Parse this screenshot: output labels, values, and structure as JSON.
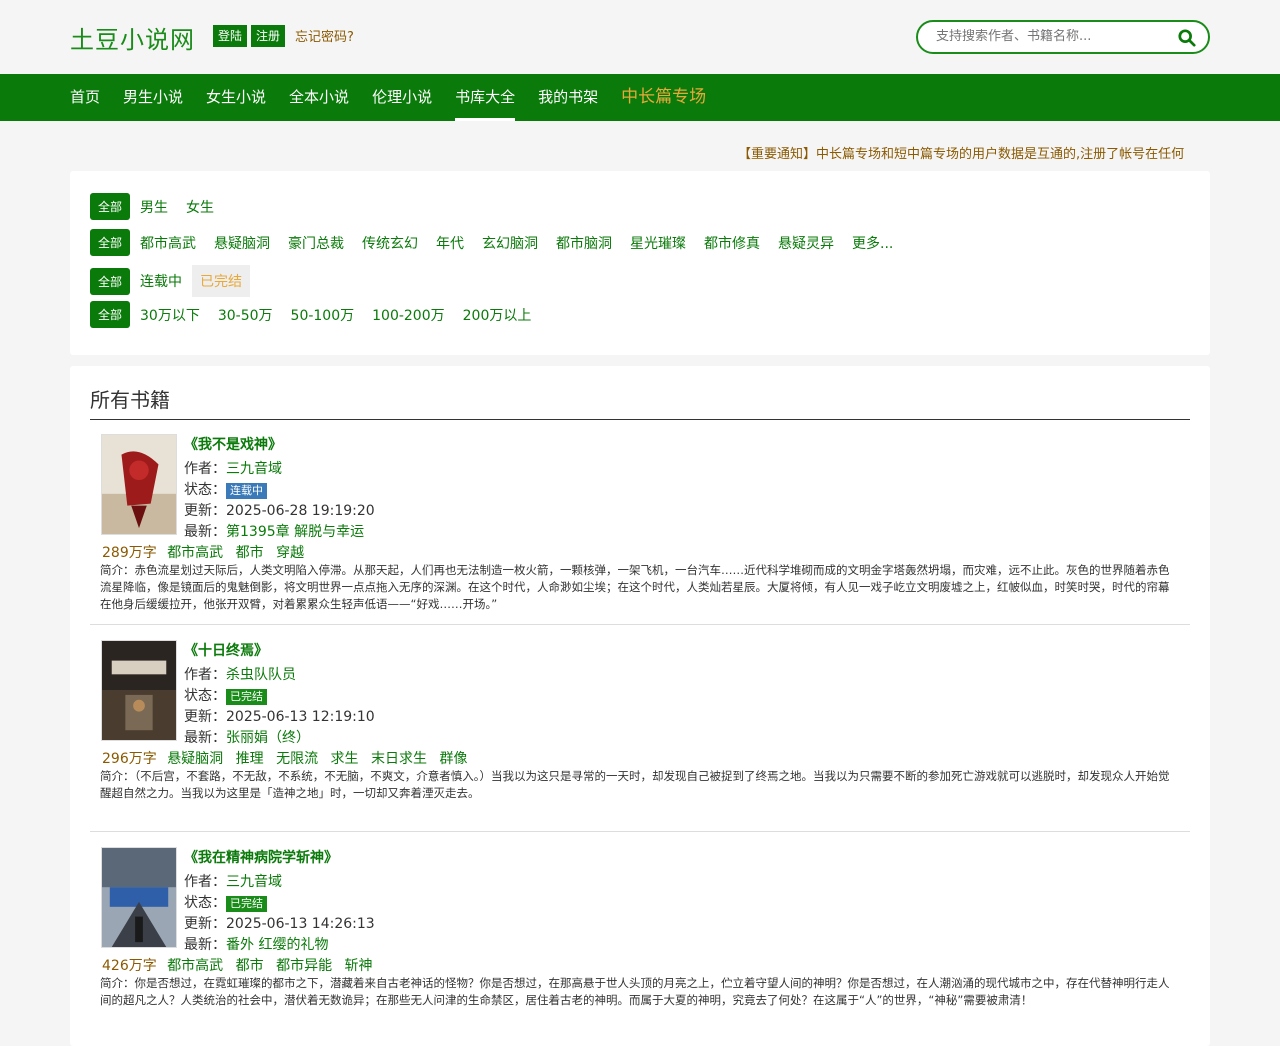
{
  "header": {
    "logo": "土豆小说网",
    "login": "登陆",
    "register": "注册",
    "forgot": "忘记密码?",
    "search_placeholder": "支持搜索作者、书籍名称..."
  },
  "nav": {
    "items": [
      "首页",
      "男生小说",
      "女生小说",
      "全本小说",
      "伦理小说",
      "书库大全",
      "我的书架",
      "中长篇专场"
    ],
    "active": "书库大全"
  },
  "notice": "【重要通知】中长篇专场和短中篇专场的用户数据是互通的,注册了帐号在任何",
  "filters": {
    "all_label": "全部",
    "gender": [
      "男生",
      "女生"
    ],
    "category": [
      "都市高武",
      "悬疑脑洞",
      "豪门总裁",
      "传统玄幻",
      "年代",
      "玄幻脑洞",
      "都市脑洞",
      "星光璀璨",
      "都市修真",
      "悬疑灵异",
      "更多..."
    ],
    "status": [
      "连载中",
      "已完结"
    ],
    "status_selected": "已完结",
    "words": [
      "30万以下",
      "30-50万",
      "50-100万",
      "100-200万",
      "200万以上"
    ]
  },
  "section_title": "所有书籍",
  "labels": {
    "author": "作者：",
    "status": "状态：",
    "update": "更新：",
    "latest": "最新：",
    "intro": "简介："
  },
  "books": [
    {
      "title": "《我不是戏神》",
      "author": "三九音域",
      "status": "连载中",
      "updated": "2025-06-28 19:19:20",
      "latest": "第1395章 解脱与幸运",
      "words": "289万字",
      "tags": [
        "都市高武",
        "都市",
        "穿越"
      ],
      "intro": "赤色流星划过天际后，人类文明陷入停滞。从那天起，人们再也无法制造一枚火箭，一颗核弹，一架飞机，一台汽车……近代科学堆砌而成的文明金字塔轰然坍塌，而灾难，远不止此。灰色的世界随着赤色流星降临，像是镜面后的鬼魅倒影，将文明世界一点点拖入无序的深渊。在这个时代，人命渺如尘埃；在这个时代，人类灿若星辰。大厦将倾，有人见一戏子屹立文明废墟之上，红帔似血，时笑时哭，时代的帘幕在他身后缓缓拉开，他张开双臂，对着累累众生轻声低语——“好戏……开场。”"
    },
    {
      "title": "《十日终焉》",
      "author": "杀虫队队员",
      "status": "已完结",
      "updated": "2025-06-13 12:19:10",
      "latest": "张丽娟（终）",
      "words": "296万字",
      "tags": [
        "悬疑脑洞",
        "推理",
        "无限流",
        "求生",
        "末日求生",
        "群像"
      ],
      "intro": "（不后宫，不套路，不无敌，不系统，不无脑，不爽文，介意者慎入。）当我以为这只是寻常的一天时，却发现自己被捉到了终焉之地。当我以为只需要不断的参加死亡游戏就可以逃脱时，却发现众人开始觉醒超自然之力。当我以为这里是「造神之地」时，一切却又奔着湮灭走去。"
    },
    {
      "title": "《我在精神病院学斩神》",
      "author": "三九音域",
      "status": "已完结",
      "updated": "2025-06-13 14:26:13",
      "latest": "番外 红缨的礼物",
      "words": "426万字",
      "tags": [
        "都市高武",
        "都市",
        "都市异能",
        "斩神"
      ],
      "intro": "你是否想过，在霓虹璀璨的都市之下，潜藏着来自古老神话的怪物？你是否想过，在那高悬于世人头顶的月亮之上，伫立着守望人间的神明？你是否想过，在人潮汹涌的现代城市之中，存在代替神明行走人间的超凡之人？人类统治的社会中，潜伏着无数诡异；在那些无人问津的生命禁区，居住着古老的神明。而属于大夏的神明，究竟去了何处？在这属于“人”的世界，“神秘”需要被肃清！"
    }
  ],
  "colors": {
    "brand_green": "#0a7a0a",
    "accent_orange": "#e8a93a",
    "ongoing_blue": "#3a7ab8"
  }
}
